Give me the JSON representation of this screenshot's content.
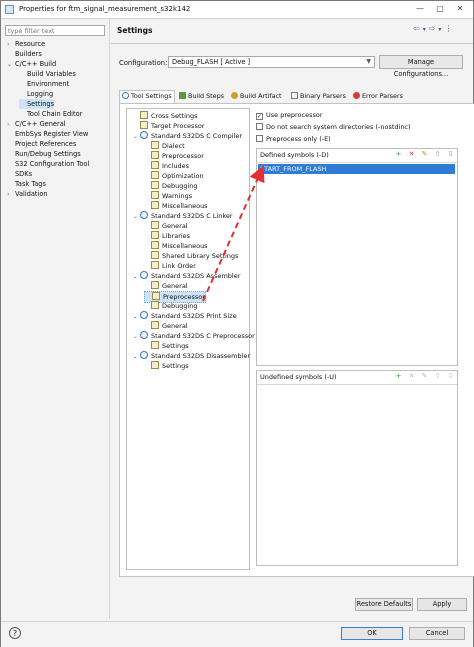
{
  "window": {
    "title": "Properties for ftm_signal_measurement_s32k142",
    "minimize": "—",
    "maximize": "▢",
    "close": "✕"
  },
  "filter": {
    "placeholder": "type filter text"
  },
  "nav": [
    {
      "label": "Resource",
      "arrow": "›"
    },
    {
      "label": "Builders",
      "arrow": ""
    },
    {
      "label": "C/C++ Build",
      "arrow": "⌄"
    },
    {
      "label": "Build Variables",
      "arrow": ""
    },
    {
      "label": "Environment",
      "arrow": ""
    },
    {
      "label": "Logging",
      "arrow": ""
    },
    {
      "label": "Settings",
      "arrow": ""
    },
    {
      "label": "Tool Chain Editor",
      "arrow": ""
    },
    {
      "label": "C/C++ General",
      "arrow": "›"
    },
    {
      "label": "EmbSys Register View",
      "arrow": ""
    },
    {
      "label": "Project References",
      "arrow": ""
    },
    {
      "label": "Run/Debug Settings",
      "arrow": ""
    },
    {
      "label": "S32 Configuration Tool",
      "arrow": ""
    },
    {
      "label": "SDKs",
      "arrow": ""
    },
    {
      "label": "Task Tags",
      "arrow": ""
    },
    {
      "label": "Validation",
      "arrow": "›"
    }
  ],
  "header": {
    "title": "Settings",
    "back": "⇦",
    "dd1": "▾",
    "forward": "⇨",
    "dd2": "▾",
    "menu": "⋮"
  },
  "configuration": {
    "label": "Configuration:",
    "value": "Debug_FLASH  [ Active ]",
    "manage": "Manage Configurations..."
  },
  "tabs": [
    {
      "label": "Tool Settings",
      "color": "#3f73b8"
    },
    {
      "label": "Build Steps",
      "color": "#5a9a3c"
    },
    {
      "label": "Build Artifact",
      "color": "#d49a2a"
    },
    {
      "label": "Binary Parsers",
      "color": "#777777"
    },
    {
      "label": "Error Parsers",
      "color": "#d23b3b"
    }
  ],
  "tree": [
    {
      "label": "Cross Settings",
      "tw": ""
    },
    {
      "label": "Target Processor",
      "tw": ""
    },
    {
      "label": "Standard S32DS C Compiler",
      "tw": "⌄"
    },
    {
      "label": "Dialect",
      "tw": ""
    },
    {
      "label": "Preprocessor",
      "tw": ""
    },
    {
      "label": "Includes",
      "tw": ""
    },
    {
      "label": "Optimization",
      "tw": ""
    },
    {
      "label": "Debugging",
      "tw": ""
    },
    {
      "label": "Warnings",
      "tw": ""
    },
    {
      "label": "Miscellaneous",
      "tw": ""
    },
    {
      "label": "Standard S32DS C Linker",
      "tw": "⌄"
    },
    {
      "label": "General",
      "tw": ""
    },
    {
      "label": "Libraries",
      "tw": ""
    },
    {
      "label": "Miscellaneous",
      "tw": ""
    },
    {
      "label": "Shared Library Settings",
      "tw": ""
    },
    {
      "label": "Link Order",
      "tw": ""
    },
    {
      "label": "Standard S32DS Assembler",
      "tw": "⌄"
    },
    {
      "label": "General",
      "tw": ""
    },
    {
      "label": "Preprocessor",
      "tw": ""
    },
    {
      "label": "Debugging",
      "tw": ""
    },
    {
      "label": "Standard S32DS Print Size",
      "tw": "⌄"
    },
    {
      "label": "General",
      "tw": ""
    },
    {
      "label": "Standard S32DS C Preprocessor",
      "tw": "⌄"
    },
    {
      "label": "Settings",
      "tw": ""
    },
    {
      "label": "Standard S32DS Disassembler",
      "tw": "⌄"
    },
    {
      "label": "Settings",
      "tw": ""
    }
  ],
  "options": {
    "use_preprocessor": {
      "label": "Use preprocessor",
      "checked": "✓"
    },
    "nostdinc": {
      "label": "Do not search system directories (-nostdinc)",
      "checked": ""
    },
    "preprocess_only": {
      "label": "Preprocess only (-E)",
      "checked": ""
    }
  },
  "defined": {
    "header": "Defined symbols (-D)",
    "items": [
      "START_FROM_FLASH"
    ]
  },
  "undefined": {
    "header": "Undefined symbols (-U)"
  },
  "buttons": {
    "restore": "Restore Defaults",
    "apply": "Apply",
    "ok": "OK",
    "cancel": "Cancel"
  },
  "help": "?",
  "annotation_color": "#e03030"
}
